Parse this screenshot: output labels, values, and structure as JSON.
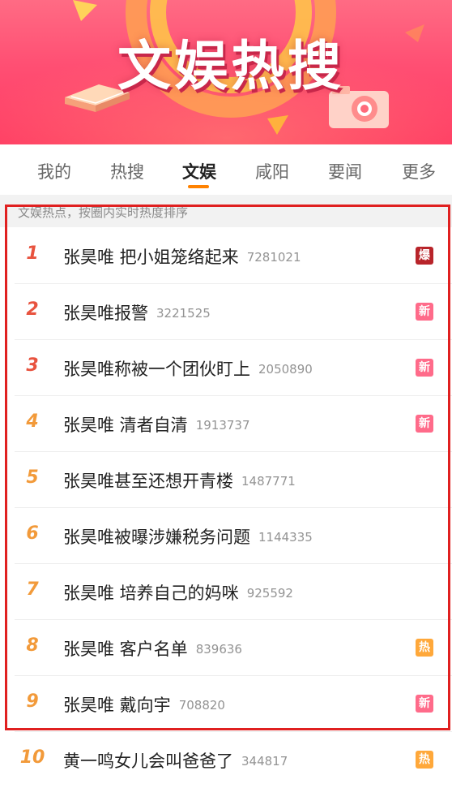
{
  "banner": {
    "title": "文娱热搜"
  },
  "tabs": [
    {
      "label": "我的"
    },
    {
      "label": "热搜"
    },
    {
      "label": "文娱"
    },
    {
      "label": "咸阳"
    },
    {
      "label": "要闻"
    },
    {
      "label": "更多"
    }
  ],
  "active_tab": "文娱",
  "subtitle": "文娱热点，按圈内实时热度排序",
  "colors": {
    "accent": "#ff8200",
    "rank_top": "#e8533f",
    "rank_mid": "#f29a3a",
    "badge_bao": "#b8242a",
    "badge_xin": "#ff6b8a",
    "badge_re": "#ffa83a",
    "highlight": "#e02020"
  },
  "items": [
    {
      "rank": "1",
      "topic": "张昊唯 把小姐笼络起来",
      "count": "7281021",
      "badge": "爆",
      "badge_color": "#b8242a",
      "rank_color": "#e8533f"
    },
    {
      "rank": "2",
      "topic": "张昊唯报警",
      "count": "3221525",
      "badge": "新",
      "badge_color": "#ff6b8a",
      "rank_color": "#e8533f"
    },
    {
      "rank": "3",
      "topic": "张昊唯称被一个团伙盯上",
      "count": "2050890",
      "badge": "新",
      "badge_color": "#ff6b8a",
      "rank_color": "#e8533f"
    },
    {
      "rank": "4",
      "topic": "张昊唯 清者自清",
      "count": "1913737",
      "badge": "新",
      "badge_color": "#ff6b8a",
      "rank_color": "#f29a3a"
    },
    {
      "rank": "5",
      "topic": "张昊唯甚至还想开青楼",
      "count": "1487771",
      "badge": "",
      "badge_color": "",
      "rank_color": "#f29a3a"
    },
    {
      "rank": "6",
      "topic": "张昊唯被曝涉嫌税务问题",
      "count": "1144335",
      "badge": "",
      "badge_color": "",
      "rank_color": "#f29a3a"
    },
    {
      "rank": "7",
      "topic": "张昊唯 培养自己的妈咪",
      "count": "925592",
      "badge": "",
      "badge_color": "",
      "rank_color": "#f29a3a"
    },
    {
      "rank": "8",
      "topic": "张昊唯 客户名单",
      "count": "839636",
      "badge": "热",
      "badge_color": "#ffa83a",
      "rank_color": "#f29a3a"
    },
    {
      "rank": "9",
      "topic": "张昊唯 戴向宇",
      "count": "708820",
      "badge": "新",
      "badge_color": "#ff6b8a",
      "rank_color": "#f29a3a"
    },
    {
      "rank": "10",
      "topic": "黄一鸣女儿会叫爸爸了",
      "count": "344817",
      "badge": "热",
      "badge_color": "#ffa83a",
      "rank_color": "#f29a3a"
    }
  ]
}
